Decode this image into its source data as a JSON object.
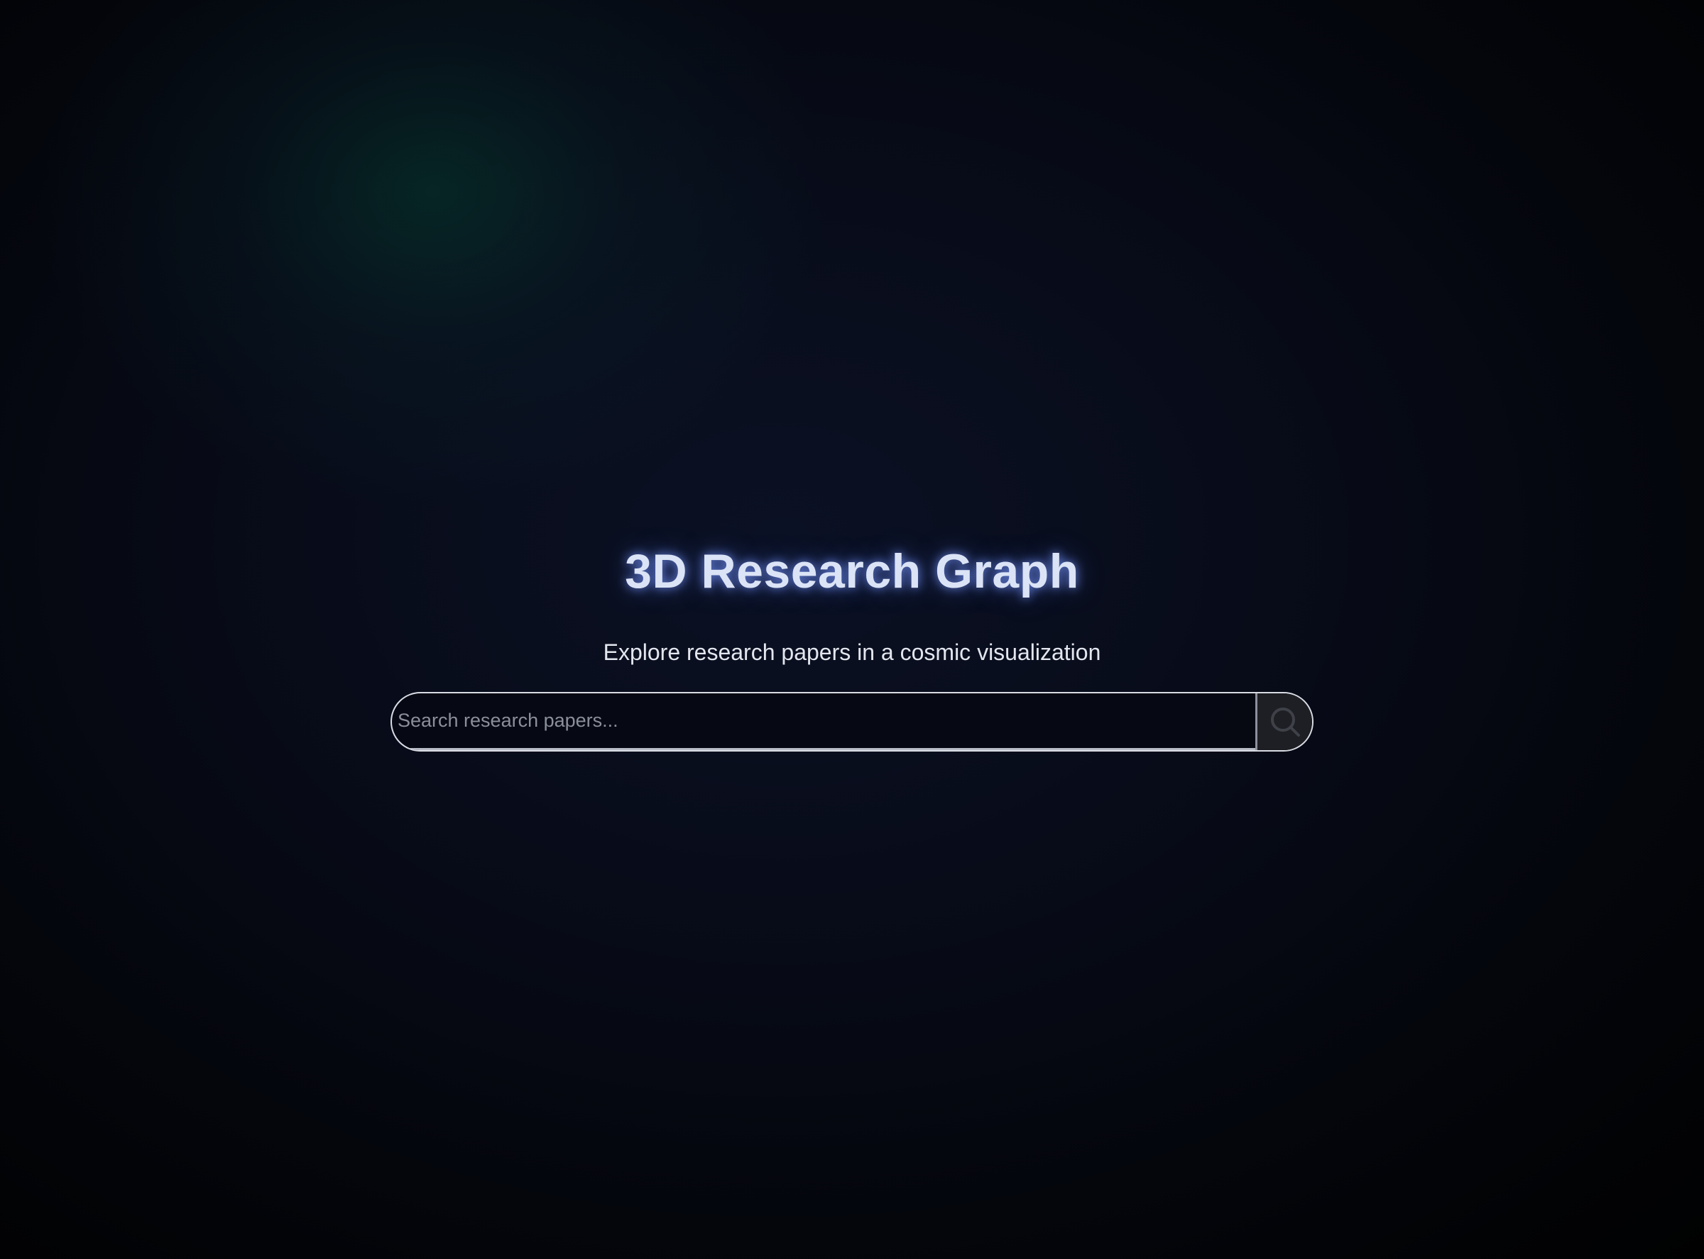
{
  "page": {
    "title": "3D Research Graph",
    "subtitle": "Explore research papers in a cosmic visualization"
  },
  "search": {
    "value": "",
    "placeholder": "Search research papers...",
    "button_icon": "search-icon"
  },
  "colors": {
    "title_text": "#dbe3f6",
    "title_glow": "#7896ff",
    "background_dark": "#000000",
    "background_glow_teal": "#063c30",
    "search_border": "#d9dce3",
    "search_button_bg": "#1e1f24"
  }
}
